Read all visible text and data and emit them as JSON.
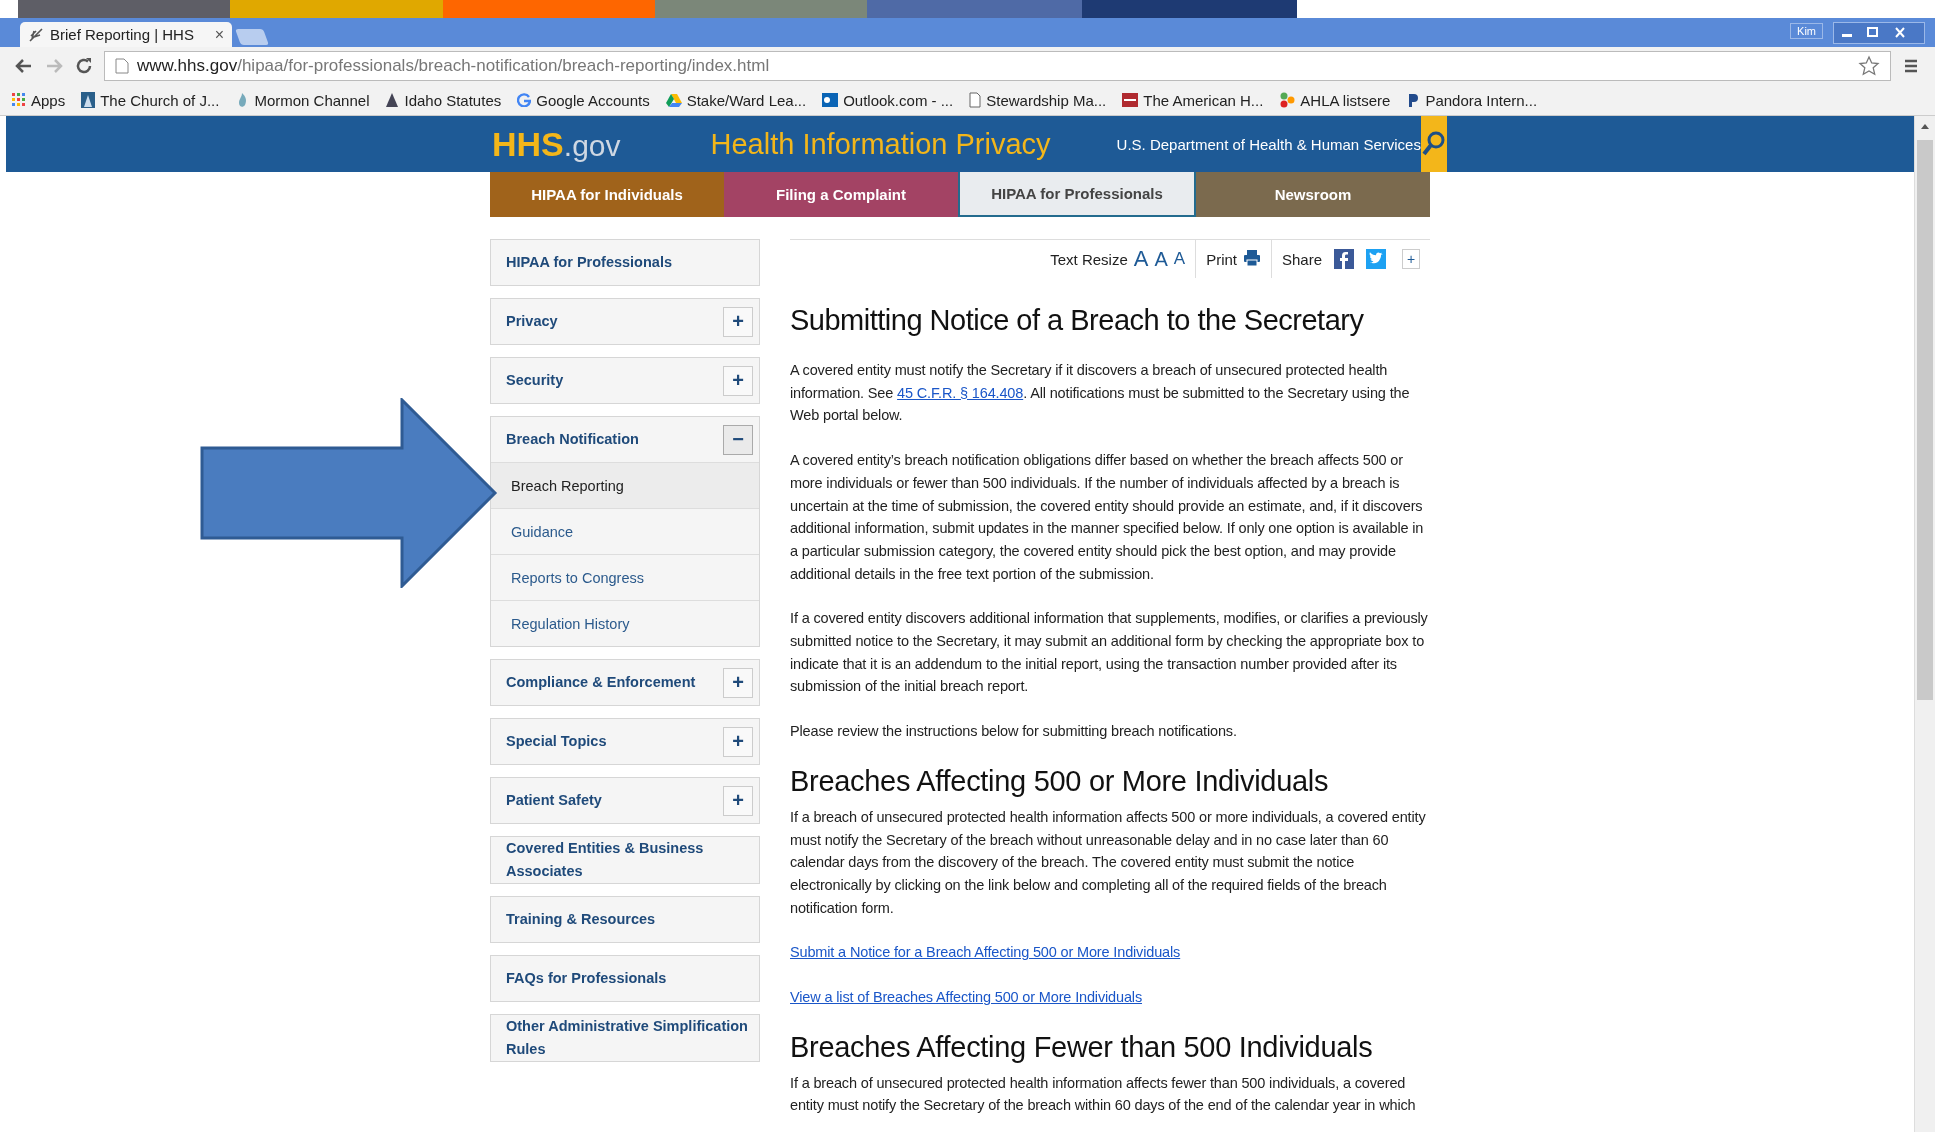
{
  "browser": {
    "tab": {
      "title": "Brief Reporting | HHS",
      "close": "×"
    },
    "profile": "Kim",
    "url": {
      "host": "www.hhs.gov",
      "path": "/hipaa/for-professionals/breach-notification/breach-reporting/index.html"
    },
    "bookmarks": [
      {
        "label": "Apps",
        "kind": "apps"
      },
      {
        "label": "The Church of J...",
        "kind": "church"
      },
      {
        "label": "Mormon Channel",
        "kind": "channel"
      },
      {
        "label": "Idaho Statutes",
        "kind": "statutes"
      },
      {
        "label": "Google Accounts",
        "kind": "google"
      },
      {
        "label": "Stake/Ward Lea...",
        "kind": "drive"
      },
      {
        "label": "Outlook.com - ...",
        "kind": "outlook"
      },
      {
        "label": "Stewardship Ma...",
        "kind": "page"
      },
      {
        "label": "The American H...",
        "kind": "ahla"
      },
      {
        "label": "AHLA listsere",
        "kind": "dots"
      },
      {
        "label": "Pandora Intern...",
        "kind": "pandora"
      }
    ]
  },
  "site": {
    "logo": {
      "main": "HHS",
      "suffix": ".gov"
    },
    "title": "Health Information Privacy",
    "department": "U.S. Department of Health & Human Services",
    "nav": [
      {
        "label": "HIPAA for Individuals",
        "color": "#a0631b",
        "selected": false
      },
      {
        "label": "Filing a Complaint",
        "color": "#a34364",
        "selected": false
      },
      {
        "label": "HIPAA for Professionals",
        "color": "#236b8e",
        "selected": true
      },
      {
        "label": "Newsroom",
        "color": "#7b6a4e",
        "selected": false
      }
    ],
    "toolbar": {
      "resize_label": "Text Resize",
      "resize_letters": [
        "A",
        "A",
        "A"
      ],
      "print": "Print",
      "share": "Share",
      "more": "+"
    }
  },
  "sidebar": [
    {
      "label": "HIPAA for Professionals",
      "kind": "plain"
    },
    {
      "label": "Privacy",
      "kind": "expandable",
      "expanded": false,
      "toggle": "+"
    },
    {
      "label": "Security",
      "kind": "expandable",
      "expanded": false,
      "toggle": "+"
    },
    {
      "label": "Breach Notification",
      "kind": "expandable",
      "expanded": true,
      "toggle": "−",
      "children": [
        {
          "label": "Breach Reporting",
          "selected": true
        },
        {
          "label": "Guidance",
          "selected": false
        },
        {
          "label": "Reports to Congress",
          "selected": false
        },
        {
          "label": "Regulation History",
          "selected": false
        }
      ]
    },
    {
      "label": "Compliance & Enforcement",
      "kind": "expandable",
      "expanded": false,
      "toggle": "+"
    },
    {
      "label": "Special Topics",
      "kind": "expandable",
      "expanded": false,
      "toggle": "+"
    },
    {
      "label": "Patient Safety",
      "kind": "expandable",
      "expanded": false,
      "toggle": "+"
    },
    {
      "label": "Covered Entities & Business Associates",
      "kind": "plain"
    },
    {
      "label": "Training & Resources",
      "kind": "plain"
    },
    {
      "label": "FAQs for Professionals",
      "kind": "plain"
    },
    {
      "label": "Other Administrative Simplification Rules",
      "kind": "plain"
    }
  ],
  "content": [
    {
      "kind": "title",
      "text": "Submitting Notice of a Breach to the Secretary"
    },
    {
      "kind": "paragraph_link",
      "before": "A covered entity must notify the Secretary if it discovers a breach of unsecured protected health information. See ",
      "link": "45 C.F.R. § 164.408",
      "after": ". All notifications must be submitted to the Secretary using the Web portal below."
    },
    {
      "kind": "paragraph",
      "text": "A covered entity’s breach notification obligations differ based on whether the breach affects 500 or more individuals or fewer than 500 individuals. If the number of individuals affected by a breach is uncertain at the time of submission, the covered entity should provide an estimate, and, if it discovers additional information, submit updates in the manner specified below. If only one option is available in a particular submission category, the covered entity should pick the best option, and may provide additional details in the free text portion of the submission."
    },
    {
      "kind": "paragraph",
      "text": "If a covered entity discovers additional information that supplements, modifies, or clarifies a previously submitted notice to the Secretary, it may submit an additional form by checking the appropriate box to indicate that it is an addendum to the initial report, using the transaction number provided after its submission of the initial breach report."
    },
    {
      "kind": "paragraph",
      "text": "Please review the instructions below for submitting breach notifications."
    },
    {
      "kind": "heading",
      "text": "Breaches Affecting 500 or More Individuals"
    },
    {
      "kind": "paragraph",
      "text": "If a breach of unsecured protected health information affects 500 or more individuals, a covered entity must notify the Secretary of the breach without unreasonable delay and in no case later than 60 calendar days from the discovery of the breach. The covered entity must submit the notice electronically by clicking on the link below and completing all of the required fields of the breach notification form."
    },
    {
      "kind": "link",
      "text": "Submit a Notice for a Breach Affecting 500 or More Individuals"
    },
    {
      "kind": "link",
      "text": "View a list of Breaches Affecting 500 or More Individuals"
    },
    {
      "kind": "heading",
      "text": "Breaches Affecting Fewer than 500 Individuals"
    },
    {
      "kind": "paragraph",
      "text": "If a breach of unsecured protected health information affects fewer than 500 individuals, a covered entity must notify the Secretary of the breach within 60 days of the end of the calendar year in which"
    }
  ]
}
